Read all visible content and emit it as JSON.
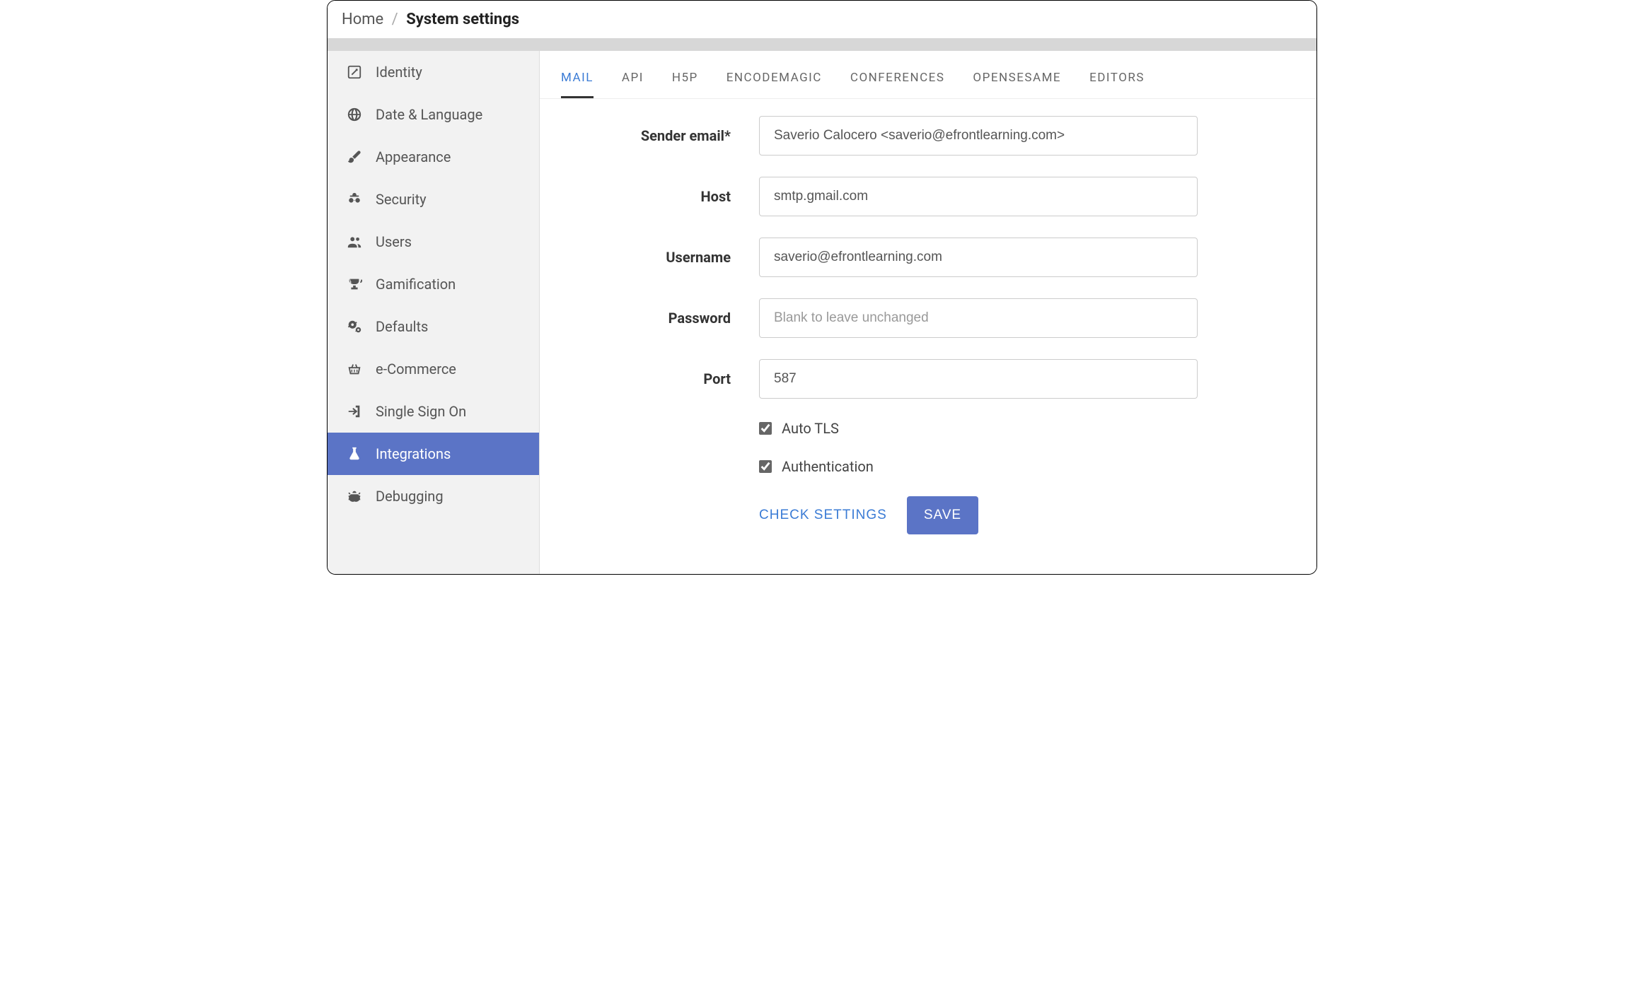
{
  "breadcrumb": {
    "home": "Home",
    "separator": "/",
    "title": "System settings"
  },
  "sidebar": {
    "items": [
      {
        "id": "identity",
        "label": "Identity"
      },
      {
        "id": "date-language",
        "label": "Date & Language"
      },
      {
        "id": "appearance",
        "label": "Appearance"
      },
      {
        "id": "security",
        "label": "Security"
      },
      {
        "id": "users",
        "label": "Users"
      },
      {
        "id": "gamification",
        "label": "Gamification"
      },
      {
        "id": "defaults",
        "label": "Defaults"
      },
      {
        "id": "ecommerce",
        "label": "e-Commerce"
      },
      {
        "id": "sso",
        "label": "Single Sign On"
      },
      {
        "id": "integrations",
        "label": "Integrations"
      },
      {
        "id": "debugging",
        "label": "Debugging"
      }
    ],
    "active": "integrations"
  },
  "tabs": {
    "items": [
      {
        "id": "mail",
        "label": "MAIL"
      },
      {
        "id": "api",
        "label": "API"
      },
      {
        "id": "h5p",
        "label": "H5P"
      },
      {
        "id": "encodemagic",
        "label": "ENCODEMAGIC"
      },
      {
        "id": "conferences",
        "label": "CONFERENCES"
      },
      {
        "id": "opensesame",
        "label": "OPENSESAME"
      },
      {
        "id": "editors",
        "label": "EDITORS"
      }
    ],
    "active": "mail"
  },
  "form": {
    "sender_email": {
      "label": "Sender email*",
      "value": "Saverio Calocero <saverio@efrontlearning.com>"
    },
    "host": {
      "label": "Host",
      "value": "smtp.gmail.com"
    },
    "username": {
      "label": "Username",
      "value": "saverio@efrontlearning.com"
    },
    "password": {
      "label": "Password",
      "placeholder": "Blank to leave unchanged",
      "value": ""
    },
    "port": {
      "label": "Port",
      "value": "587"
    },
    "auto_tls": {
      "label": "Auto TLS",
      "checked": true
    },
    "authentication": {
      "label": "Authentication",
      "checked": true
    }
  },
  "actions": {
    "check_settings": "CHECK SETTINGS",
    "save": "SAVE"
  },
  "colors": {
    "accent": "#5b74c6",
    "link": "#3a7bd5",
    "sidebar_bg": "#f2f2f2"
  }
}
